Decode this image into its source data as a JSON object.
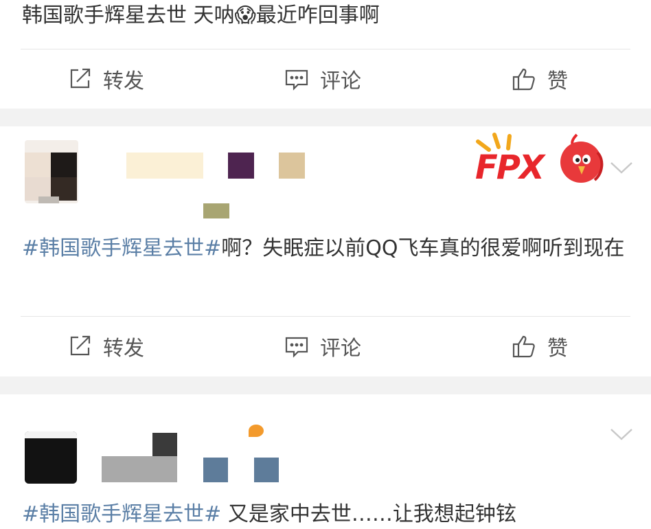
{
  "post1": {
    "text": "韩国歌手辉星去世 天呐😱最近咋回事啊",
    "actions": {
      "repost": "转发",
      "comment": "评论",
      "like": "赞"
    }
  },
  "post2": {
    "hashtag": "#韩国歌手辉星去世#",
    "text": "啊？失眠症以前QQ飞车真的很爱啊听到现在",
    "badge_text": "FPX",
    "actions": {
      "repost": "转发",
      "comment": "评论",
      "like": "赞"
    }
  },
  "post3": {
    "hashtag": "#韩国歌手辉星去世#",
    "text": " 又是家中去世……让我想起钟铉"
  },
  "icons": {
    "repost": "repost-icon",
    "comment": "comment-icon",
    "like": "like-icon",
    "more": "chevron-down-icon"
  },
  "colors": {
    "hashtag": "#5b7fa6",
    "text": "#333333",
    "action_text": "#555555",
    "separator": "#f2f2f2",
    "badge_red": "#e8262b"
  }
}
